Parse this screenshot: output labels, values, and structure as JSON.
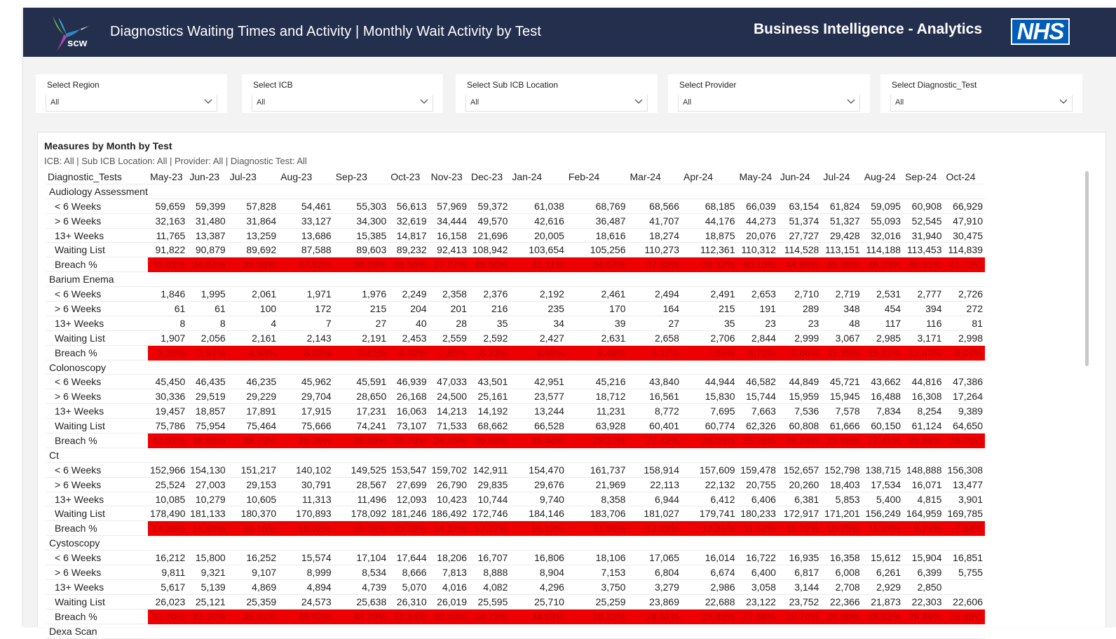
{
  "header": {
    "logo_text": "SCW",
    "title": "Diagnostics Waiting Times and Activity | Monthly Wait Activity by Test",
    "right_title": "Business Intelligence - Analytics",
    "nhs_logo": "NHS"
  },
  "slicers": [
    {
      "label": "Select Region",
      "value": "All"
    },
    {
      "label": "Select ICB",
      "value": "All"
    },
    {
      "label": "Select Sub ICB Location",
      "value": "All"
    },
    {
      "label": "Select Provider",
      "value": "All"
    },
    {
      "label": "Select Diagnostic_Test",
      "value": "All"
    }
  ],
  "visual": {
    "title": "Measures by Month by Test",
    "subtitle": "ICB: All | Sub ICB Location: All | Provider: All | Diagnostic Test: All",
    "column_header": "Diagnostic_Tests",
    "months": [
      "May-23",
      "Jun-23",
      "Jul-23",
      "Aug-23",
      "Sep-23",
      "Oct-23",
      "Nov-23",
      "Dec-23",
      "Jan-24",
      "Feb-24",
      "Mar-24",
      "Apr-24",
      "May-24",
      "Jun-24",
      "Jul-24",
      "Aug-24",
      "Sep-24",
      "Oct-24"
    ],
    "groups": [
      {
        "name": "Audiology Assessments",
        "rows": [
          {
            "label": "< 6 Weeks",
            "values": [
              "59,659",
              "59,399",
              "57,828",
              "54,461",
              "55,303",
              "56,613",
              "57,969",
              "59,372",
              "61,038",
              "68,769",
              "68,566",
              "68,185",
              "66,039",
              "63,154",
              "61,824",
              "59,095",
              "60,908",
              "66,929"
            ]
          },
          {
            "label": "> 6 Weeks",
            "values": [
              "32,163",
              "31,480",
              "31,864",
              "33,127",
              "34,300",
              "32,619",
              "34,444",
              "49,570",
              "42,616",
              "36,487",
              "41,707",
              "44,176",
              "44,273",
              "51,374",
              "51,327",
              "55,093",
              "52,545",
              "47,910"
            ]
          },
          {
            "label": "13+ Weeks",
            "values": [
              "11,765",
              "13,387",
              "13,259",
              "13,686",
              "15,385",
              "14,817",
              "16,158",
              "21,696",
              "20,005",
              "18,616",
              "18,274",
              "18,875",
              "20,076",
              "27,727",
              "29,428",
              "32,016",
              "31,940",
              "30,475"
            ]
          },
          {
            "label": "Waiting List",
            "values": [
              "91,822",
              "90,879",
              "89,692",
              "87,588",
              "89,603",
              "89,232",
              "92,413",
              "108,942",
              "103,654",
              "105,256",
              "110,273",
              "112,361",
              "110,312",
              "114,528",
              "113,151",
              "114,188",
              "113,453",
              "114,839"
            ]
          },
          {
            "label": "Breach %",
            "breach": true,
            "values": [
              "35.03%",
              "34.64%",
              "35.53%",
              "37.82%",
              "38.28%",
              "36.56%",
              "37.27%",
              "45.50%",
              "41.11%",
              "34.67%",
              "37.82%",
              "39.32%",
              "40.13%",
              "44.86%",
              "45.36%",
              "48.25%",
              "46.31%",
              "41.72%"
            ]
          }
        ]
      },
      {
        "name": "Barium Enema",
        "rows": [
          {
            "label": "< 6 Weeks",
            "values": [
              "1,846",
              "1,995",
              "2,061",
              "1,971",
              "1,976",
              "2,249",
              "2,358",
              "2,376",
              "2,192",
              "2,461",
              "2,494",
              "2,491",
              "2,653",
              "2,710",
              "2,719",
              "2,531",
              "2,777",
              "2,726"
            ]
          },
          {
            "label": "> 6 Weeks",
            "values": [
              "61",
              "61",
              "100",
              "172",
              "215",
              "204",
              "201",
              "216",
              "235",
              "170",
              "164",
              "215",
              "191",
              "289",
              "348",
              "454",
              "394",
              "272"
            ]
          },
          {
            "label": "13+ Weeks",
            "values": [
              "8",
              "8",
              "4",
              "7",
              "27",
              "40",
              "28",
              "35",
              "34",
              "39",
              "27",
              "35",
              "23",
              "23",
              "48",
              "117",
              "116",
              "81"
            ]
          },
          {
            "label": "Waiting List",
            "values": [
              "1,907",
              "2,056",
              "2,161",
              "2,143",
              "2,191",
              "2,453",
              "2,559",
              "2,592",
              "2,427",
              "2,631",
              "2,658",
              "2,706",
              "2,844",
              "2,999",
              "3,067",
              "2,985",
              "3,171",
              "2,998"
            ]
          },
          {
            "label": "Breach %",
            "breach": true,
            "values": [
              "3.20%",
              "2.97%",
              "4.63%",
              "8.03%",
              "9.81%",
              "8.32%",
              "7.85%",
              "8.33%",
              "9.68%",
              "6.46%",
              "6.17%",
              "7.95%",
              "6.72%",
              "9.64%",
              "11.35%",
              "15.21%",
              "12.43%",
              "9.07%"
            ]
          }
        ]
      },
      {
        "name": "Colonoscopy",
        "rows": [
          {
            "label": "< 6 Weeks",
            "values": [
              "45,450",
              "46,435",
              "46,235",
              "45,962",
              "45,591",
              "46,939",
              "47,033",
              "43,501",
              "42,951",
              "45,216",
              "43,840",
              "44,944",
              "46,582",
              "44,849",
              "45,721",
              "43,662",
              "44,816",
              "47,386"
            ]
          },
          {
            "label": "> 6 Weeks",
            "values": [
              "30,336",
              "29,519",
              "29,229",
              "29,704",
              "28,650",
              "26,168",
              "24,500",
              "25,161",
              "23,577",
              "18,712",
              "16,561",
              "15,830",
              "15,744",
              "15,959",
              "15,945",
              "16,488",
              "16,308",
              "17,264"
            ]
          },
          {
            "label": "13+ Weeks",
            "values": [
              "19,457",
              "18,857",
              "17,891",
              "17,915",
              "17,231",
              "16,063",
              "14,213",
              "14,192",
              "13,244",
              "11,231",
              "8,772",
              "7,695",
              "7,663",
              "7,536",
              "7,578",
              "7,834",
              "8,254",
              "9,389"
            ]
          },
          {
            "label": "Waiting List",
            "values": [
              "75,786",
              "75,954",
              "75,464",
              "75,666",
              "74,241",
              "73,107",
              "71,533",
              "68,662",
              "66,528",
              "63,928",
              "60,401",
              "60,774",
              "62,326",
              "60,808",
              "61,666",
              "60,150",
              "61,124",
              "64,650"
            ]
          },
          {
            "label": "Breach %",
            "breach": true,
            "values": [
              "40.03%",
              "38.86%",
              "38.73%",
              "39.26%",
              "38.59%",
              "35.79%",
              "34.25%",
              "36.64%",
              "35.44%",
              "29.27%",
              "27.42%",
              "26.05%",
              "25.26%",
              "26.24%",
              "25.86%",
              "27.41%",
              "26.68%",
              "26.70%"
            ]
          }
        ]
      },
      {
        "name": "Ct",
        "rows": [
          {
            "label": "< 6 Weeks",
            "values": [
              "152,966",
              "154,130",
              "151,217",
              "140,102",
              "149,525",
              "153,547",
              "159,702",
              "142,911",
              "154,470",
              "161,737",
              "158,914",
              "157,609",
              "159,478",
              "152,657",
              "152,798",
              "138,715",
              "148,888",
              "156,308"
            ]
          },
          {
            "label": "> 6 Weeks",
            "values": [
              "25,524",
              "27,003",
              "29,153",
              "30,791",
              "28,567",
              "27,699",
              "26,790",
              "29,835",
              "29,676",
              "21,969",
              "22,113",
              "22,132",
              "20,755",
              "20,260",
              "18,403",
              "17,534",
              "16,071",
              "13,477"
            ]
          },
          {
            "label": "13+ Weeks",
            "values": [
              "10,085",
              "10,279",
              "10,605",
              "11,313",
              "11,496",
              "12,093",
              "10,423",
              "10,744",
              "9,740",
              "8,358",
              "6,944",
              "6,412",
              "6,406",
              "6,381",
              "5,853",
              "5,400",
              "4,815",
              "3,901"
            ]
          },
          {
            "label": "Waiting List",
            "values": [
              "178,490",
              "181,133",
              "180,370",
              "170,893",
              "178,092",
              "181,246",
              "186,492",
              "172,746",
              "184,146",
              "183,706",
              "181,027",
              "179,741",
              "180,233",
              "172,917",
              "171,201",
              "156,249",
              "164,959",
              "169,785"
            ]
          },
          {
            "label": "Breach %",
            "breach": true,
            "values": [
              "14.30%",
              "14.91%",
              "16.16%",
              "18.02%",
              "16.04%",
              "15.28%",
              "14.37%",
              "17.27%",
              "16.12%",
              "11.96%",
              "12.22%",
              "12.31%",
              "11.52%",
              "11.72%",
              "10.75%",
              "11.22%",
              "9.74%",
              "7.94%"
            ]
          }
        ]
      },
      {
        "name": "Cystoscopy",
        "rows": [
          {
            "label": "< 6 Weeks",
            "values": [
              "16,212",
              "15,800",
              "16,252",
              "15,574",
              "17,104",
              "17,644",
              "18,206",
              "16,707",
              "16,806",
              "18,106",
              "17,065",
              "16,014",
              "16,722",
              "16,935",
              "16,358",
              "15,612",
              "15,904",
              "16,851"
            ]
          },
          {
            "label": "> 6 Weeks",
            "values": [
              "9,811",
              "9,321",
              "9,107",
              "8,999",
              "8,534",
              "8,666",
              "7,813",
              "8,888",
              "8,904",
              "7,153",
              "6,804",
              "6,674",
              "6,400",
              "6,817",
              "6,008",
              "6,261",
              "6,399",
              "5,755"
            ]
          },
          {
            "label": "13+ Weeks",
            "values": [
              "5,617",
              "5,139",
              "4,869",
              "4,894",
              "4,739",
              "5,070",
              "4,016",
              "4,082",
              "4,296",
              "3,750",
              "3,279",
              "2,986",
              "3,058",
              "3,144",
              "2,708",
              "2,929",
              "2,850"
            ]
          },
          {
            "label": "Waiting List",
            "values": [
              "26,023",
              "25,121",
              "25,359",
              "24,573",
              "25,638",
              "26,310",
              "26,019",
              "25,595",
              "25,710",
              "25,259",
              "23,869",
              "22,688",
              "23,122",
              "23,752",
              "22,366",
              "21,873",
              "22,303",
              "22,606"
            ]
          },
          {
            "label": "Breach %",
            "breach": true,
            "values": [
              "37.70%",
              "37.10%",
              "35.91%",
              "36.62%",
              "33.29%",
              "32.94%",
              "30.03%",
              "34.73%",
              "34.63%",
              "28.32%",
              "28.51%",
              "29.42%",
              "27.68%",
              "28.70%",
              "26.86%",
              "28.62%",
              "28.69%",
              "25.46%"
            ]
          }
        ]
      },
      {
        "name": "Dexa Scan",
        "rows": []
      }
    ]
  }
}
